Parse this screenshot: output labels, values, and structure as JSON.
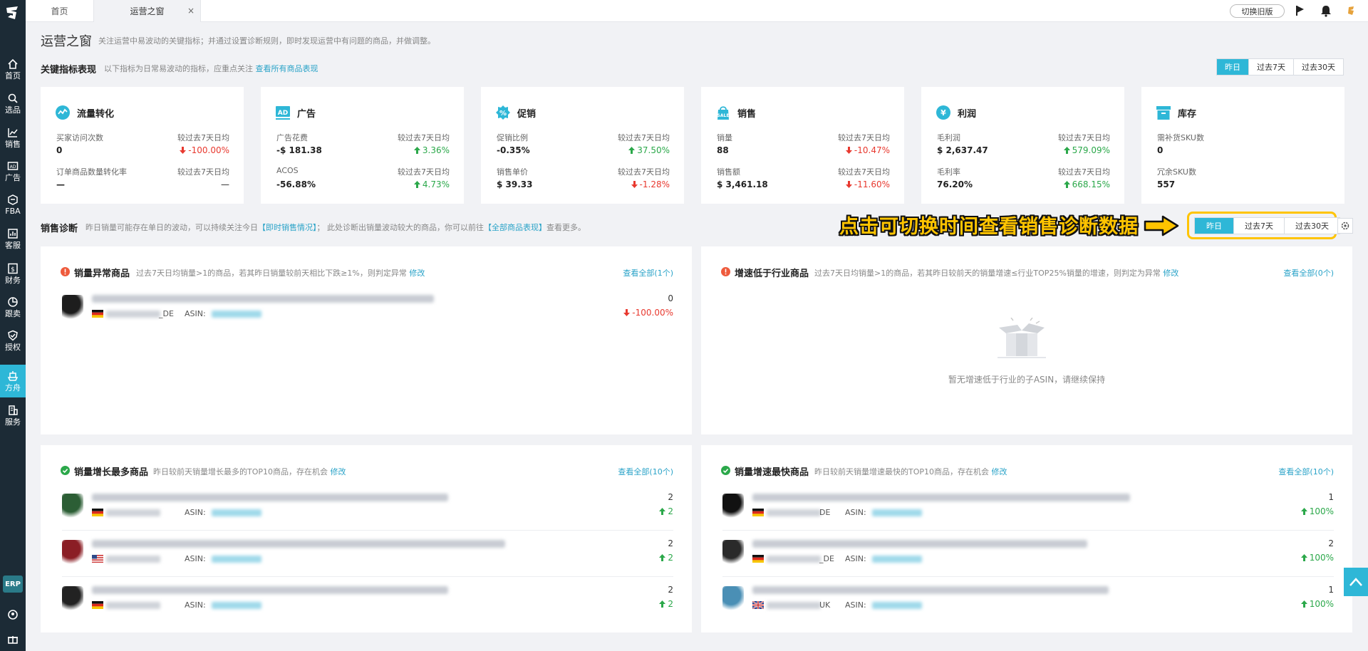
{
  "sidebar": {
    "items": [
      {
        "label": "首页",
        "icon": "home-icon"
      },
      {
        "label": "选品",
        "icon": "search-icon"
      },
      {
        "label": "销售",
        "icon": "trend-chart-icon"
      },
      {
        "label": "广告",
        "icon": "ad-icon"
      },
      {
        "label": "FBA",
        "icon": "box-icon"
      },
      {
        "label": "客服",
        "icon": "bar-chart-icon"
      },
      {
        "label": "财务",
        "icon": "dollar-icon"
      },
      {
        "label": "跟卖",
        "icon": "pie-chart-icon"
      },
      {
        "label": "授权",
        "icon": "shield-check-icon"
      },
      {
        "label": "方舟",
        "icon": "ark-icon"
      },
      {
        "label": "服务",
        "icon": "building-icon"
      }
    ],
    "active_index": 9,
    "erp_label": "ERP"
  },
  "tabs": [
    {
      "label": "首页"
    },
    {
      "label": "运营之窗"
    }
  ],
  "topbar": {
    "old_version_label": "切换旧版"
  },
  "page": {
    "title": "运营之窗",
    "description": "关注运营中易波动的关键指标；并通过设置诊断规则，即时发现运营中有问题的商品，并做调整。"
  },
  "kpi_section": {
    "title": "关键指标表现",
    "description": "以下指标为日常易波动的指标，应重点关注",
    "link": "查看所有商品表现",
    "ranges": [
      "昨日",
      "过去7天",
      "过去30天"
    ],
    "selected_range": 0
  },
  "cards": [
    {
      "title": "流量转化",
      "icon": "traffic-icon",
      "metrics": [
        {
          "label": "买家访问次数",
          "value": "0",
          "compare": "较过去7天日均",
          "change": "-100.00%",
          "dir": "down"
        },
        {
          "label": "订单商品数量转化率",
          "value": "—",
          "compare": "较过去7天日均",
          "change": "—",
          "dir": "flat"
        }
      ]
    },
    {
      "title": "广告",
      "icon": "ad-badge-icon",
      "metrics": [
        {
          "label": "广告花费",
          "value": "-$ 181.38",
          "compare": "较过去7天日均",
          "change": "3.36%",
          "dir": "up"
        },
        {
          "label": "ACOS",
          "value": "-56.88%",
          "compare": "较过去7天日均",
          "change": "4.73%",
          "dir": "up"
        }
      ]
    },
    {
      "title": "促销",
      "icon": "percent-badge-icon",
      "metrics": [
        {
          "label": "促销比例",
          "value": "-0.35%",
          "compare": "较过去7天日均",
          "change": "37.50%",
          "dir": "up"
        },
        {
          "label": "销售单价",
          "value": "$ 39.33",
          "compare": "较过去7天日均",
          "change": "-1.28%",
          "dir": "down"
        }
      ]
    },
    {
      "title": "销售",
      "icon": "sale-bag-icon",
      "metrics": [
        {
          "label": "销量",
          "value": "88",
          "compare": "较过去7天日均",
          "change": "-10.47%",
          "dir": "down"
        },
        {
          "label": "销售额",
          "value": "$ 3,461.18",
          "compare": "较过去7天日均",
          "change": "-11.60%",
          "dir": "down"
        }
      ]
    },
    {
      "title": "利润",
      "icon": "yen-coin-icon",
      "metrics": [
        {
          "label": "毛利润",
          "value": "$ 2,637.47",
          "compare": "较过去7天日均",
          "change": "579.09%",
          "dir": "up"
        },
        {
          "label": "毛利率",
          "value": "76.20%",
          "compare": "较过去7天日均",
          "change": "668.15%",
          "dir": "up"
        }
      ]
    },
    {
      "title": "库存",
      "icon": "inventory-box-icon",
      "metrics": [
        {
          "label": "需补货SKU数",
          "value": "0",
          "compare": "",
          "change": "",
          "dir": "flat"
        },
        {
          "label": "冗余SKU数",
          "value": "557",
          "compare": "",
          "change": "",
          "dir": "flat"
        }
      ]
    }
  ],
  "diag_section": {
    "title": "销售诊断",
    "desc_a": "昨日销量可能存在单日的波动，可以持续关注今日",
    "link_a": "【即时销售情况】",
    "desc_b": "；  此处诊断出销量波动较大的商品，你可以前往",
    "link_b": "【全部商品表现】",
    "desc_c": "查看更多。",
    "callout": "点击可切换时间查看销售诊断数据",
    "ranges": [
      "昨日",
      "过去7天",
      "过去30天"
    ],
    "selected_range": 0
  },
  "panels": [
    {
      "title": "销量异常商品",
      "type": "warn",
      "desc": "过去7天日均销量>1的商品，若其昨日销量较前天相比下跌≥1%，则判定异常",
      "edit": "修改",
      "more": "查看全部(1个)",
      "rows": [
        {
          "shop_suffix": "_DE",
          "asin_label": "ASIN:",
          "value": "0",
          "change": "-100.00%",
          "dir": "down",
          "flag": "de"
        }
      ],
      "empty": ""
    },
    {
      "title": "增速低于行业商品",
      "type": "warn",
      "desc": "过去7天日均销量>1的商品，若其昨日较前天的销量增速≤行业TOP25%销量的增速，则判定为异常",
      "edit": "修改",
      "more": "查看全部(0个)",
      "rows": [],
      "empty": "暂无增速低于行业的子ASIN，请继续保持"
    },
    {
      "title": "销量增长最多商品",
      "type": "ok",
      "desc": "昨日较前天销量增长最多的TOP10商品，存在机会",
      "edit": "修改",
      "more": "查看全部(10个)",
      "rows": [
        {
          "shop_suffix": "",
          "asin_label": "ASIN:",
          "value": "2",
          "change": "2",
          "dir": "up",
          "flag": "de"
        },
        {
          "shop_suffix": "",
          "asin_label": "ASIN:",
          "value": "2",
          "change": "2",
          "dir": "up",
          "flag": "us"
        },
        {
          "shop_suffix": "",
          "asin_label": "ASIN:",
          "value": "2",
          "change": "2",
          "dir": "up",
          "flag": "de"
        }
      ],
      "empty": ""
    },
    {
      "title": "销量增速最快商品",
      "type": "ok",
      "desc": "昨日较前天销量增速最快的TOP10商品，存在机会",
      "edit": "修改",
      "more": "查看全部(10个)",
      "rows": [
        {
          "shop_suffix": "DE",
          "asin_label": "ASIN:",
          "value": "1",
          "change": "100%",
          "dir": "up",
          "flag": "de"
        },
        {
          "shop_suffix": "_DE",
          "asin_label": "ASIN:",
          "value": "2",
          "change": "100%",
          "dir": "up",
          "flag": "de"
        },
        {
          "shop_suffix": "UK",
          "asin_label": "ASIN:",
          "value": "1",
          "change": "100%",
          "dir": "up",
          "flag": "uk"
        }
      ],
      "empty": ""
    }
  ],
  "colors": {
    "accent": "#2eb7d7",
    "sidebar": "#1c2b36",
    "up": "#2ba84a",
    "down": "#e8392f",
    "warn": "#ee5a3c",
    "ok": "#2ba84a",
    "callout": "#ffc400"
  }
}
